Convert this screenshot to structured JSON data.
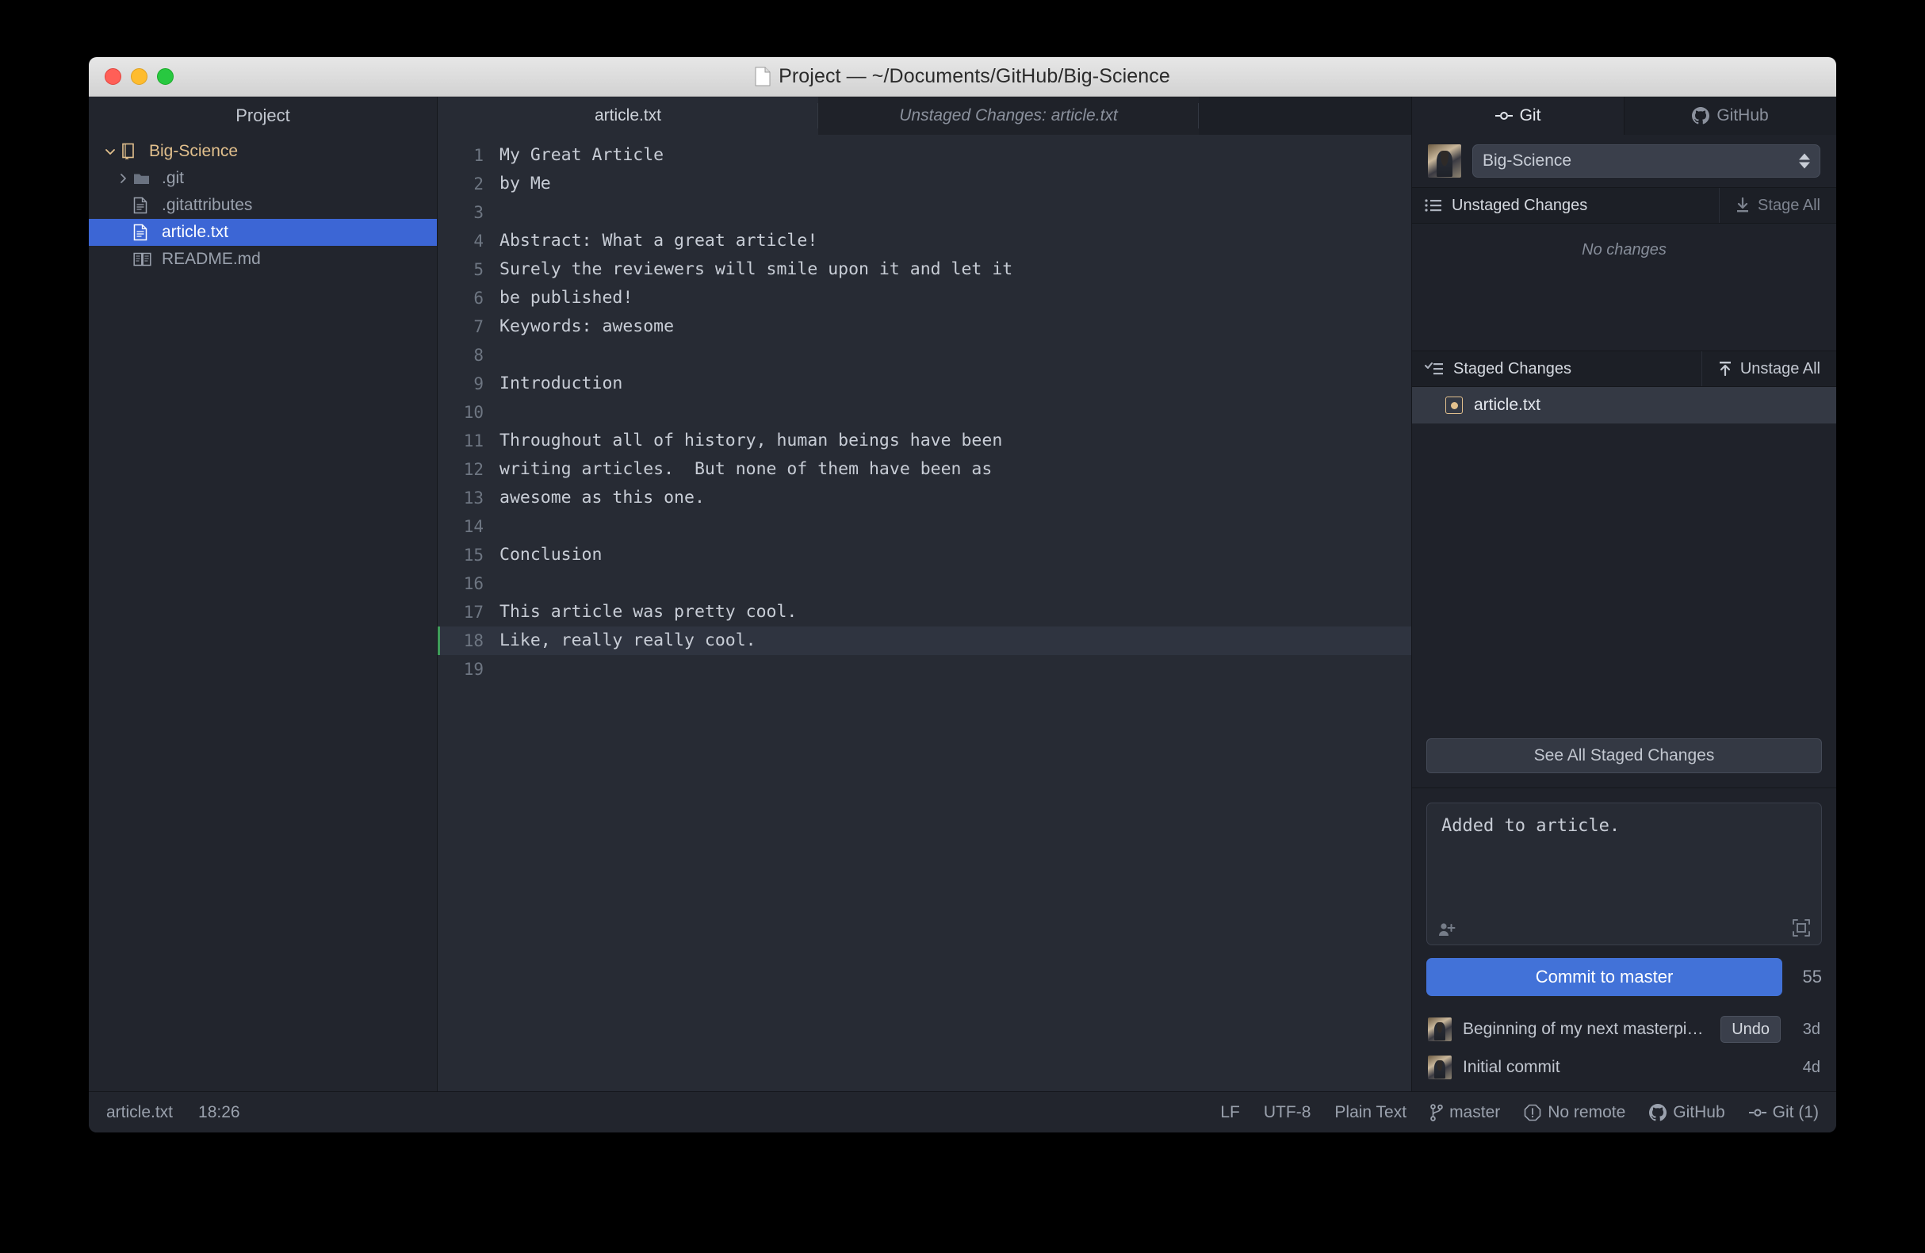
{
  "window": {
    "title": "Project — ~/Documents/GitHub/Big-Science",
    "traffic_lights": [
      "close",
      "minimize",
      "zoom"
    ]
  },
  "sidebar": {
    "header": "Project",
    "items": [
      {
        "label": "Big-Science",
        "icon": "book-icon",
        "depth": 0,
        "expanded": true,
        "selected": false
      },
      {
        "label": ".git",
        "icon": "folder-icon",
        "depth": 1,
        "expanded": false,
        "selected": false
      },
      {
        "label": ".gitattributes",
        "icon": "file-text-icon",
        "depth": 1,
        "selected": false
      },
      {
        "label": "article.txt",
        "icon": "file-text-icon",
        "depth": 1,
        "selected": true
      },
      {
        "label": "README.md",
        "icon": "readme-icon",
        "depth": 1,
        "selected": false
      }
    ]
  },
  "editor": {
    "tabs": [
      {
        "label": "article.txt",
        "active": true
      },
      {
        "label": "Unstaged Changes: article.txt",
        "active": false
      }
    ],
    "active_line": 18,
    "lines": [
      {
        "n": 1,
        "text": "My Great Article"
      },
      {
        "n": 2,
        "text": "by Me"
      },
      {
        "n": 3,
        "text": ""
      },
      {
        "n": 4,
        "text": "Abstract: What a great article!"
      },
      {
        "n": 5,
        "text": "Surely the reviewers will smile upon it and let it"
      },
      {
        "n": 6,
        "text": "be published!"
      },
      {
        "n": 7,
        "text": "Keywords: awesome"
      },
      {
        "n": 8,
        "text": ""
      },
      {
        "n": 9,
        "text": "Introduction"
      },
      {
        "n": 10,
        "text": ""
      },
      {
        "n": 11,
        "text": "Throughout all of history, human beings have been"
      },
      {
        "n": 12,
        "text": "writing articles.  But none of them have been as"
      },
      {
        "n": 13,
        "text": "awesome as this one."
      },
      {
        "n": 14,
        "text": ""
      },
      {
        "n": 15,
        "text": "Conclusion"
      },
      {
        "n": 16,
        "text": ""
      },
      {
        "n": 17,
        "text": "This article was pretty cool."
      },
      {
        "n": 18,
        "text": "Like, really really cool."
      },
      {
        "n": 19,
        "text": ""
      }
    ]
  },
  "git_panel": {
    "tabs": [
      {
        "label": "Git",
        "icon": "git-commit-icon",
        "active": true
      },
      {
        "label": "GitHub",
        "icon": "github-icon",
        "active": false
      }
    ],
    "repo": {
      "name": "Big-Science",
      "avatar": "user-avatar"
    },
    "unstaged": {
      "title": "Unstaged Changes",
      "action": "Stage All",
      "action_icon": "download-icon",
      "empty_text": "No changes",
      "files": []
    },
    "staged": {
      "title": "Staged Changes",
      "action": "Unstage All",
      "action_icon": "upload-icon",
      "files": [
        {
          "name": "article.txt",
          "status": "modified",
          "selected": true
        }
      ]
    },
    "see_all_label": "See All Staged Changes",
    "commit": {
      "message": "Added to article.",
      "button_label": "Commit to master",
      "char_count": "55",
      "coauthor_icon": "add-person-icon",
      "expand_icon": "expand-icon"
    },
    "history": [
      {
        "message": "Beginning of my next masterpie…",
        "undo_label": "Undo",
        "age": "3d",
        "has_undo": true
      },
      {
        "message": "Initial commit",
        "age": "4d",
        "has_undo": false
      }
    ]
  },
  "statusbar": {
    "file": "article.txt",
    "cursor": "18:26",
    "line_ending": "LF",
    "encoding": "UTF-8",
    "syntax": "Plain Text",
    "branch": "master",
    "remote": "No remote",
    "github": "GitHub",
    "git": "Git (1)"
  },
  "colors": {
    "accent": "#4272d8",
    "selection": "#3c66d5",
    "folder_gold": "#e2c08d",
    "added_green": "#3f9d5a",
    "panel_bg": "#1f222a",
    "editor_bg": "#272b34"
  }
}
